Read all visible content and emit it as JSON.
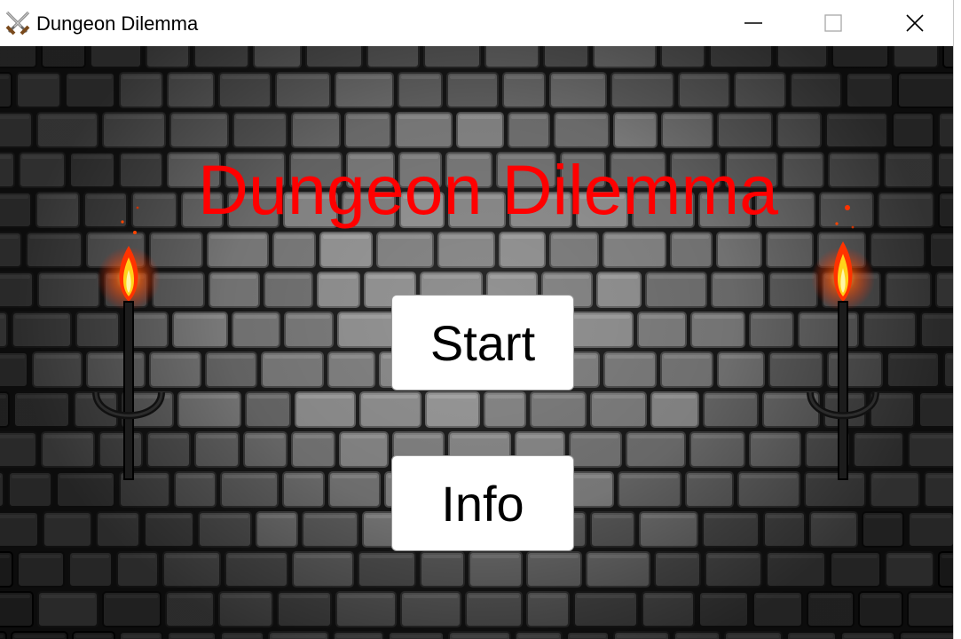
{
  "window": {
    "title": "Dungeon Dilemma",
    "app_icon": "crossed-swords-icon",
    "controls": {
      "minimize_icon": "minimize-icon",
      "maximize_icon": "maximize-icon",
      "close_icon": "close-icon"
    }
  },
  "game": {
    "title": "Dungeon Dilemma",
    "title_color": "#ff0000",
    "background": "stone-brick-wall",
    "buttons": {
      "start_label": "Start",
      "info_label": "Info"
    },
    "decorations": [
      "left-torch",
      "right-torch"
    ]
  }
}
